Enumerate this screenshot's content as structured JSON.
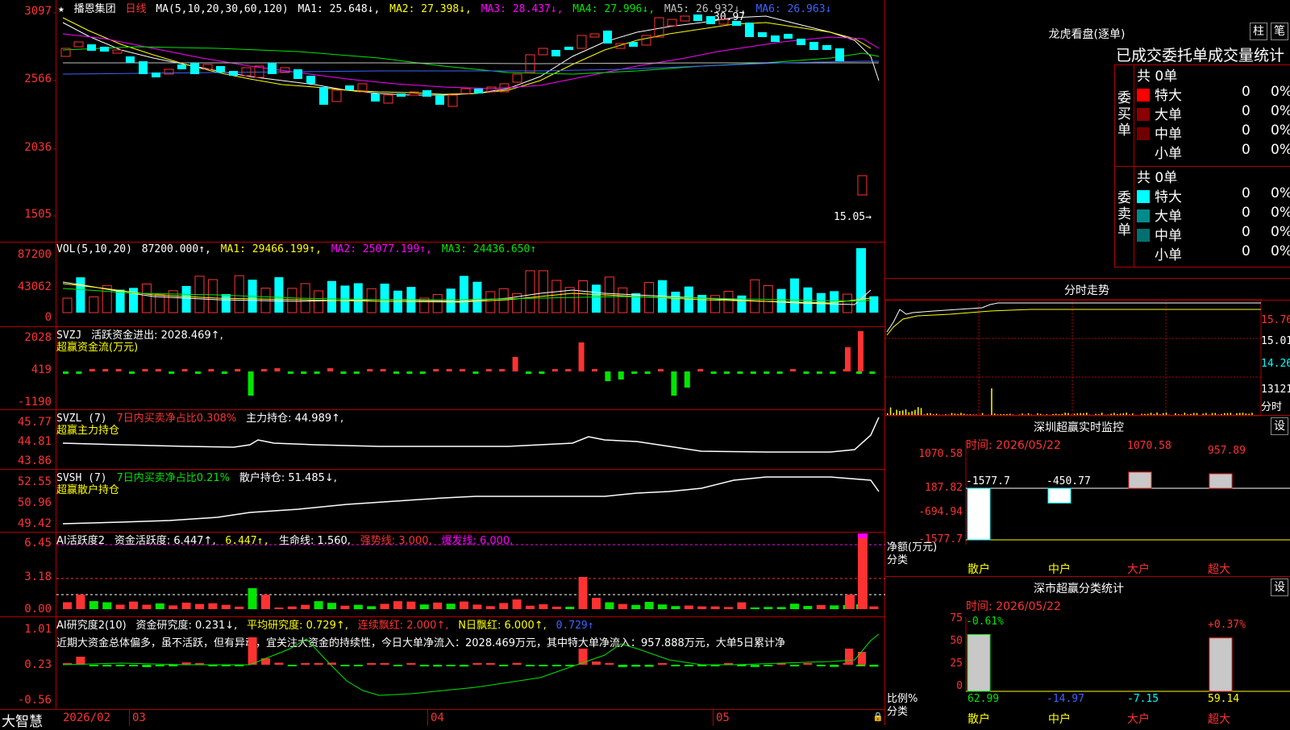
{
  "main_chart": {
    "stock_name": "播恩集团",
    "period": "日线",
    "ma_label": "MA(5,10,20,30,60,120)",
    "ma1": "MA1: 25.648↓,",
    "ma2": "MA2: 27.398↓,",
    "ma3": "MA3: 28.437↓,",
    "ma4": "MA4: 27.996↓,",
    "ma5": "MA5: 26.932↓,",
    "ma6": "MA6: 26.963↓",
    "y_ticks": [
      "3097",
      "2566",
      "2036",
      "1505"
    ],
    "high_marker": "30.97",
    "last_price": "15.05→"
  },
  "vol": {
    "label": "VOL(5,10,20)",
    "value": "87200.000↑,",
    "ma1": "MA1: 29466.199↑,",
    "ma2": "MA2: 25077.199↑,",
    "ma3": "MA3: 24436.650↑",
    "y_ticks": [
      "87200",
      "43062",
      "0"
    ]
  },
  "svzj": {
    "label": "SVZJ",
    "title": "活跃资金进出: 2028.469↑,",
    "subtitle": "超赢资金流(万元)",
    "y_ticks": [
      "2028",
      "419",
      "-1190"
    ]
  },
  "svzl": {
    "label": "SVZL (7)",
    "desc": "7日内买卖净占比0.308%",
    "hold": "主力持仓: 44.989↑,",
    "subtitle": "超赢主力持仓",
    "y_ticks": [
      "45.77",
      "44.81",
      "43.86"
    ]
  },
  "svsh": {
    "label": "SVSH (7)",
    "desc": "7日内买卖净占比0.21%",
    "hold": "散户持仓: 51.485↓,",
    "subtitle": "超赢散户持仓",
    "y_ticks": [
      "52.55",
      "50.96",
      "49.42"
    ]
  },
  "ai_active": {
    "label": "AI活跃度2",
    "act": "资金活跃度: 6.447↑,",
    "act2": "6.447↑,",
    "life": "生命线: 1.560,",
    "strong": "强势线: 3.000,",
    "burst": "爆发线: 6.000,",
    "y_ticks": [
      "6.45",
      "3.18",
      "0.00"
    ]
  },
  "ai_research": {
    "label": "AI研究度2(10)",
    "research": "资金研究度: 0.231↓,",
    "avg": "平均研究度: 0.729↑,",
    "cont": "连续飘红: 2.000↑,",
    "nday": "N日飘红: 6.000↑,",
    "extra": "0.729↑",
    "comment": "近期大资金总体偏多，虽不活跃，但有异动，宜关注大资金的持续性，今日大单净流入：2028.469万元，其中特大单净流入：957.888万元，大单5日累计净",
    "y_ticks": [
      "1.01",
      "0.23",
      "-0.56"
    ]
  },
  "x_axis": {
    "app": "大智慧",
    "labels": [
      "2026/02",
      "03",
      "04",
      "05"
    ]
  },
  "lhb": {
    "title": "龙虎看盘(逐单)",
    "btn_bar": "柱",
    "btn_pen": "笔",
    "subtitle": "已成交委托单成交量统计",
    "buy_label": "委买单",
    "sell_label": "委卖单",
    "buy_total": "共 0单",
    "sell_total": "共 0单",
    "buy_rows": [
      {
        "name": "特大",
        "count": "0",
        "pct": "0%",
        "color": "#ff0000"
      },
      {
        "name": "大单",
        "count": "0",
        "pct": "0%",
        "color": "#8b0000"
      },
      {
        "name": "中单",
        "count": "0",
        "pct": "0%",
        "color": "#700000"
      },
      {
        "name": "小单",
        "count": "0",
        "pct": "0%",
        "color": "#000000"
      }
    ],
    "sell_rows": [
      {
        "name": "特大",
        "count": "0",
        "pct": "0%",
        "color": "#00ffff"
      },
      {
        "name": "大单",
        "count": "0",
        "pct": "0%",
        "color": "#008b8b"
      },
      {
        "name": "中单",
        "count": "0",
        "pct": "0%",
        "color": "#007070"
      },
      {
        "name": "小单",
        "count": "0",
        "pct": "0%",
        "color": "#000000"
      }
    ]
  },
  "intraday": {
    "title": "分时走势",
    "y_ticks": [
      "15.76",
      "15.01",
      "14.26",
      "13121"
    ],
    "footer": "分时"
  },
  "sz_monitor": {
    "title": "深圳超赢实时监控",
    "set_btn": "设",
    "time": "时间: 2026/05/22",
    "y_ticks": [
      "1070.58",
      "187.82",
      "-694.94",
      "-1577.7"
    ],
    "side_label1": "净额(万元)",
    "side_label2": "分类",
    "cats": [
      "散户",
      "中户",
      "大户",
      "超大"
    ],
    "bar_labels": [
      "-1577.7",
      "-450.77",
      "1070.58",
      "957.89"
    ],
    "values": [
      -1577.7,
      -450.77,
      1070.58,
      957.89
    ]
  },
  "sz_class": {
    "title": "深市超赢分类统计",
    "set_btn": "设",
    "time": "时间: 2026/05/22",
    "y_ticks": [
      "75",
      "50",
      "25",
      "0"
    ],
    "side_label1": "比例%",
    "side_label2": "分类",
    "cats": [
      "散户",
      "中户",
      "大户",
      "超大"
    ],
    "top_labels": [
      "-0.61%",
      "+0.37%"
    ],
    "bottom_labels": [
      "62.99",
      "-14.97",
      "-7.15",
      "59.14"
    ],
    "values": [
      62.99,
      -14.97,
      -7.15,
      59.14
    ]
  }
}
